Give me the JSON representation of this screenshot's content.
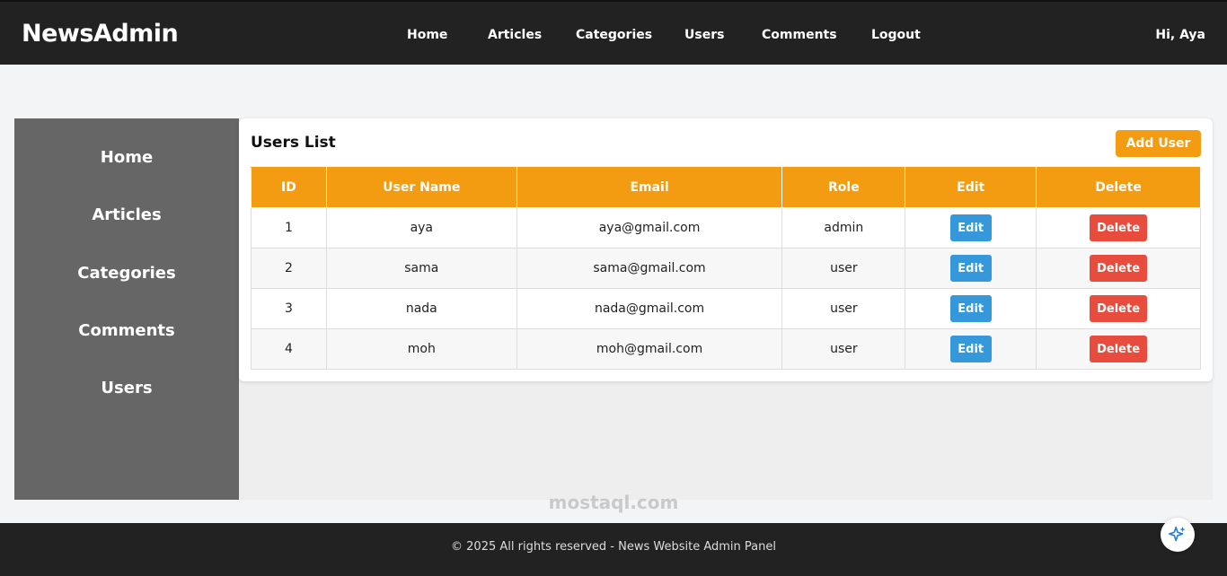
{
  "brand": "NewsAdmin",
  "topnav": [
    "Home",
    "Articles",
    "Categories",
    "Users",
    "Comments",
    "Logout"
  ],
  "greeting": "Hi, Aya",
  "sidebar": [
    "Home",
    "Articles",
    "Categories",
    "Comments",
    "Users"
  ],
  "card": {
    "title": "Users List",
    "add_button": "Add User"
  },
  "table": {
    "columns": [
      "ID",
      "User Name",
      "Email",
      "Role",
      "Edit",
      "Delete"
    ],
    "rows": [
      {
        "id": "1",
        "name": "aya",
        "email": "aya@gmail.com",
        "role": "admin"
      },
      {
        "id": "2",
        "name": "sama",
        "email": "sama@gmail.com",
        "role": "user"
      },
      {
        "id": "3",
        "name": "nada",
        "email": "nada@gmail.com",
        "role": "user"
      },
      {
        "id": "4",
        "name": "moh",
        "email": "moh@gmail.com",
        "role": "user"
      }
    ],
    "edit_label": "Edit",
    "delete_label": "Delete"
  },
  "footer": "© 2025 All rights reserved - News Website Admin Panel",
  "watermark": "mostaql.com",
  "colors": {
    "accent": "#f39c12",
    "edit": "#3498db",
    "delete": "#e74c3c",
    "header_bg": "#222222",
    "sidebar_bg": "#666666"
  },
  "icons": {
    "fab": "sparkle-icon"
  }
}
